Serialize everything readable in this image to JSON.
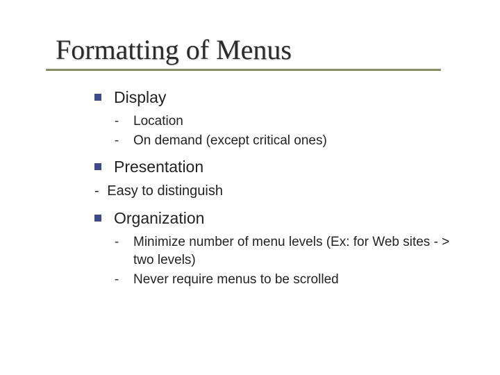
{
  "title": "Formatting of Menus",
  "items": {
    "display": {
      "label": "Display",
      "sub": {
        "a": "Location",
        "b": "On demand (except critical ones)"
      }
    },
    "presentation": {
      "label": "Presentation",
      "sub": {
        "a": "Easy to distinguish"
      }
    },
    "organization": {
      "label": "Organization",
      "sub": {
        "a": "Minimize number of menu levels (Ex: for Web sites - > two levels)",
        "b": "Never require menus to be scrolled"
      }
    }
  }
}
